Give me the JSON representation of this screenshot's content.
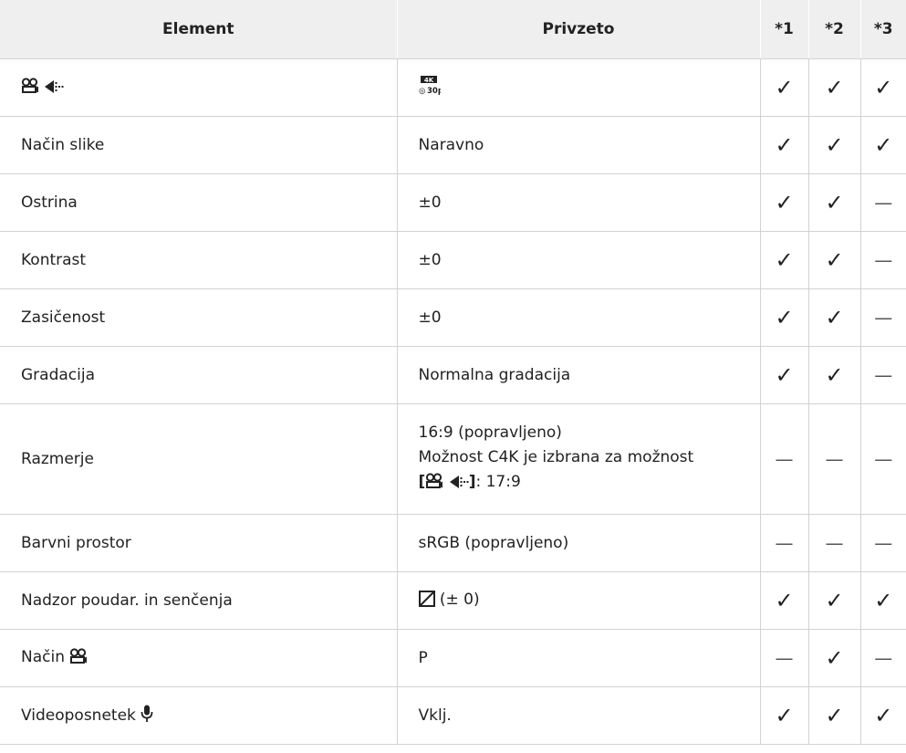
{
  "headers": {
    "element": "Element",
    "default": "Privzeto",
    "c1": "*1",
    "c2": "*2",
    "c3": "*3"
  },
  "rows": [
    {
      "element": "",
      "value": "",
      "marks": [
        "✓",
        "✓",
        "✓"
      ]
    },
    {
      "element": "Način slike",
      "value": "Naravno",
      "marks": [
        "✓",
        "✓",
        "✓"
      ]
    },
    {
      "element": "Ostrina",
      "value": "±0",
      "marks": [
        "✓",
        "✓",
        "—"
      ]
    },
    {
      "element": "Kontrast",
      "value": "±0",
      "marks": [
        "✓",
        "✓",
        "—"
      ]
    },
    {
      "element": "Zasičenost",
      "value": "±0",
      "marks": [
        "✓",
        "✓",
        "—"
      ]
    },
    {
      "element": "Gradacija",
      "value": "Normalna gradacija",
      "marks": [
        "✓",
        "✓",
        "—"
      ]
    },
    {
      "element": "Razmerje",
      "value_line1": "16:9 (popravljeno)",
      "value_line2": "Možnost C4K je izbrana za možnost",
      "value_line3_open": "[",
      "value_line3_close": "]",
      "value_line3_rest": ": 17:9",
      "marks": [
        "—",
        "—",
        "—"
      ]
    },
    {
      "element": "Barvni prostor",
      "value": "sRGB (popravljeno)",
      "marks": [
        "—",
        "—",
        "—"
      ]
    },
    {
      "element": "Nadzor poudar. in senčenja",
      "value": "(± 0)",
      "marks": [
        "✓",
        "✓",
        "✓"
      ]
    },
    {
      "element": "Način",
      "value": "P",
      "marks": [
        "—",
        "✓",
        "—"
      ]
    },
    {
      "element": "Videoposnetek",
      "value": "Vklj.",
      "marks": [
        "✓",
        "✓",
        "✓"
      ]
    }
  ],
  "icons": {
    "movie": "movie-camera-icon",
    "quality": "movie-quality-icon",
    "resolution_badge": "4k-30p-badge-icon",
    "highlight_shadow": "highlight-shadow-icon",
    "microphone": "microphone-icon"
  },
  "badge": {
    "top": "4K",
    "bottom": "30p"
  }
}
